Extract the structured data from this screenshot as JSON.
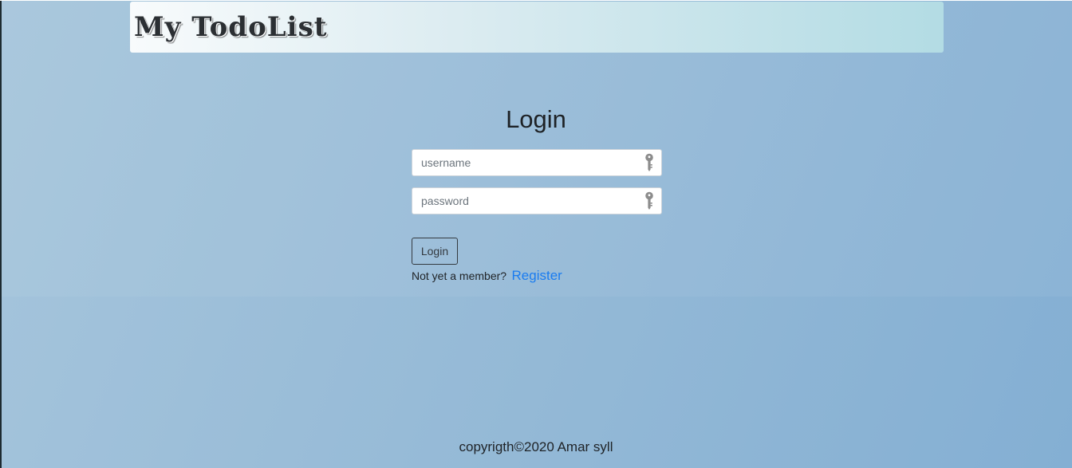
{
  "navbar": {
    "brand": "My TodoList"
  },
  "login": {
    "title": "Login",
    "username_placeholder": "username",
    "password_placeholder": "password",
    "field_icon": "key-icon",
    "button_label": "Login",
    "member_prompt": "Not yet a member?",
    "register_link": "Register"
  },
  "footer": {
    "text": "copyrigth©2020 Amar syll"
  },
  "colors": {
    "background_start": "#a6c5dc",
    "background_end": "#84afd3",
    "navbar_start": "#f8fbfc",
    "navbar_end": "#b3dce4",
    "link": "#1a7cf0"
  }
}
